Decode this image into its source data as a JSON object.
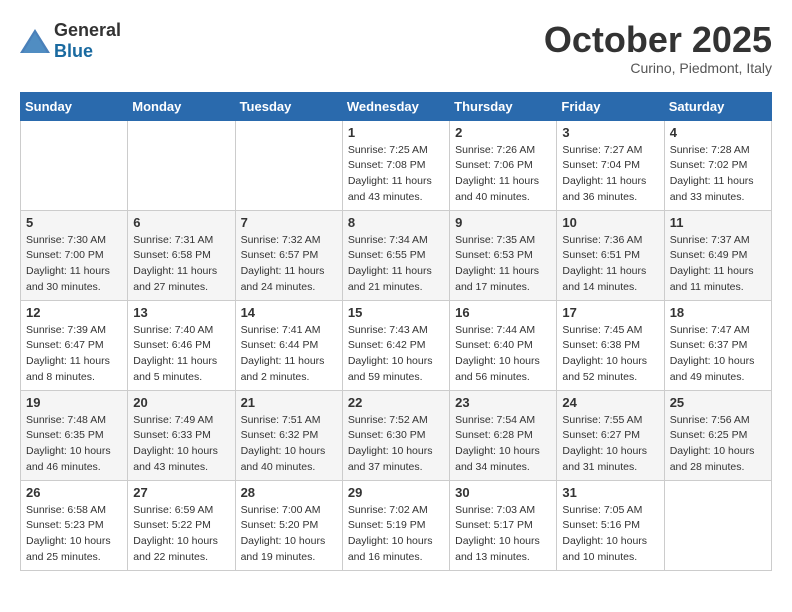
{
  "header": {
    "logo_general": "General",
    "logo_blue": "Blue",
    "month_title": "October 2025",
    "subtitle": "Curino, Piedmont, Italy"
  },
  "weekdays": [
    "Sunday",
    "Monday",
    "Tuesday",
    "Wednesday",
    "Thursday",
    "Friday",
    "Saturday"
  ],
  "weeks": [
    [
      null,
      null,
      null,
      {
        "day": "1",
        "sunrise": "Sunrise: 7:25 AM",
        "sunset": "Sunset: 7:08 PM",
        "daylight": "Daylight: 11 hours and 43 minutes."
      },
      {
        "day": "2",
        "sunrise": "Sunrise: 7:26 AM",
        "sunset": "Sunset: 7:06 PM",
        "daylight": "Daylight: 11 hours and 40 minutes."
      },
      {
        "day": "3",
        "sunrise": "Sunrise: 7:27 AM",
        "sunset": "Sunset: 7:04 PM",
        "daylight": "Daylight: 11 hours and 36 minutes."
      },
      {
        "day": "4",
        "sunrise": "Sunrise: 7:28 AM",
        "sunset": "Sunset: 7:02 PM",
        "daylight": "Daylight: 11 hours and 33 minutes."
      }
    ],
    [
      {
        "day": "5",
        "sunrise": "Sunrise: 7:30 AM",
        "sunset": "Sunset: 7:00 PM",
        "daylight": "Daylight: 11 hours and 30 minutes."
      },
      {
        "day": "6",
        "sunrise": "Sunrise: 7:31 AM",
        "sunset": "Sunset: 6:58 PM",
        "daylight": "Daylight: 11 hours and 27 minutes."
      },
      {
        "day": "7",
        "sunrise": "Sunrise: 7:32 AM",
        "sunset": "Sunset: 6:57 PM",
        "daylight": "Daylight: 11 hours and 24 minutes."
      },
      {
        "day": "8",
        "sunrise": "Sunrise: 7:34 AM",
        "sunset": "Sunset: 6:55 PM",
        "daylight": "Daylight: 11 hours and 21 minutes."
      },
      {
        "day": "9",
        "sunrise": "Sunrise: 7:35 AM",
        "sunset": "Sunset: 6:53 PM",
        "daylight": "Daylight: 11 hours and 17 minutes."
      },
      {
        "day": "10",
        "sunrise": "Sunrise: 7:36 AM",
        "sunset": "Sunset: 6:51 PM",
        "daylight": "Daylight: 11 hours and 14 minutes."
      },
      {
        "day": "11",
        "sunrise": "Sunrise: 7:37 AM",
        "sunset": "Sunset: 6:49 PM",
        "daylight": "Daylight: 11 hours and 11 minutes."
      }
    ],
    [
      {
        "day": "12",
        "sunrise": "Sunrise: 7:39 AM",
        "sunset": "Sunset: 6:47 PM",
        "daylight": "Daylight: 11 hours and 8 minutes."
      },
      {
        "day": "13",
        "sunrise": "Sunrise: 7:40 AM",
        "sunset": "Sunset: 6:46 PM",
        "daylight": "Daylight: 11 hours and 5 minutes."
      },
      {
        "day": "14",
        "sunrise": "Sunrise: 7:41 AM",
        "sunset": "Sunset: 6:44 PM",
        "daylight": "Daylight: 11 hours and 2 minutes."
      },
      {
        "day": "15",
        "sunrise": "Sunrise: 7:43 AM",
        "sunset": "Sunset: 6:42 PM",
        "daylight": "Daylight: 10 hours and 59 minutes."
      },
      {
        "day": "16",
        "sunrise": "Sunrise: 7:44 AM",
        "sunset": "Sunset: 6:40 PM",
        "daylight": "Daylight: 10 hours and 56 minutes."
      },
      {
        "day": "17",
        "sunrise": "Sunrise: 7:45 AM",
        "sunset": "Sunset: 6:38 PM",
        "daylight": "Daylight: 10 hours and 52 minutes."
      },
      {
        "day": "18",
        "sunrise": "Sunrise: 7:47 AM",
        "sunset": "Sunset: 6:37 PM",
        "daylight": "Daylight: 10 hours and 49 minutes."
      }
    ],
    [
      {
        "day": "19",
        "sunrise": "Sunrise: 7:48 AM",
        "sunset": "Sunset: 6:35 PM",
        "daylight": "Daylight: 10 hours and 46 minutes."
      },
      {
        "day": "20",
        "sunrise": "Sunrise: 7:49 AM",
        "sunset": "Sunset: 6:33 PM",
        "daylight": "Daylight: 10 hours and 43 minutes."
      },
      {
        "day": "21",
        "sunrise": "Sunrise: 7:51 AM",
        "sunset": "Sunset: 6:32 PM",
        "daylight": "Daylight: 10 hours and 40 minutes."
      },
      {
        "day": "22",
        "sunrise": "Sunrise: 7:52 AM",
        "sunset": "Sunset: 6:30 PM",
        "daylight": "Daylight: 10 hours and 37 minutes."
      },
      {
        "day": "23",
        "sunrise": "Sunrise: 7:54 AM",
        "sunset": "Sunset: 6:28 PM",
        "daylight": "Daylight: 10 hours and 34 minutes."
      },
      {
        "day": "24",
        "sunrise": "Sunrise: 7:55 AM",
        "sunset": "Sunset: 6:27 PM",
        "daylight": "Daylight: 10 hours and 31 minutes."
      },
      {
        "day": "25",
        "sunrise": "Sunrise: 7:56 AM",
        "sunset": "Sunset: 6:25 PM",
        "daylight": "Daylight: 10 hours and 28 minutes."
      }
    ],
    [
      {
        "day": "26",
        "sunrise": "Sunrise: 6:58 AM",
        "sunset": "Sunset: 5:23 PM",
        "daylight": "Daylight: 10 hours and 25 minutes."
      },
      {
        "day": "27",
        "sunrise": "Sunrise: 6:59 AM",
        "sunset": "Sunset: 5:22 PM",
        "daylight": "Daylight: 10 hours and 22 minutes."
      },
      {
        "day": "28",
        "sunrise": "Sunrise: 7:00 AM",
        "sunset": "Sunset: 5:20 PM",
        "daylight": "Daylight: 10 hours and 19 minutes."
      },
      {
        "day": "29",
        "sunrise": "Sunrise: 7:02 AM",
        "sunset": "Sunset: 5:19 PM",
        "daylight": "Daylight: 10 hours and 16 minutes."
      },
      {
        "day": "30",
        "sunrise": "Sunrise: 7:03 AM",
        "sunset": "Sunset: 5:17 PM",
        "daylight": "Daylight: 10 hours and 13 minutes."
      },
      {
        "day": "31",
        "sunrise": "Sunrise: 7:05 AM",
        "sunset": "Sunset: 5:16 PM",
        "daylight": "Daylight: 10 hours and 10 minutes."
      },
      null
    ]
  ]
}
